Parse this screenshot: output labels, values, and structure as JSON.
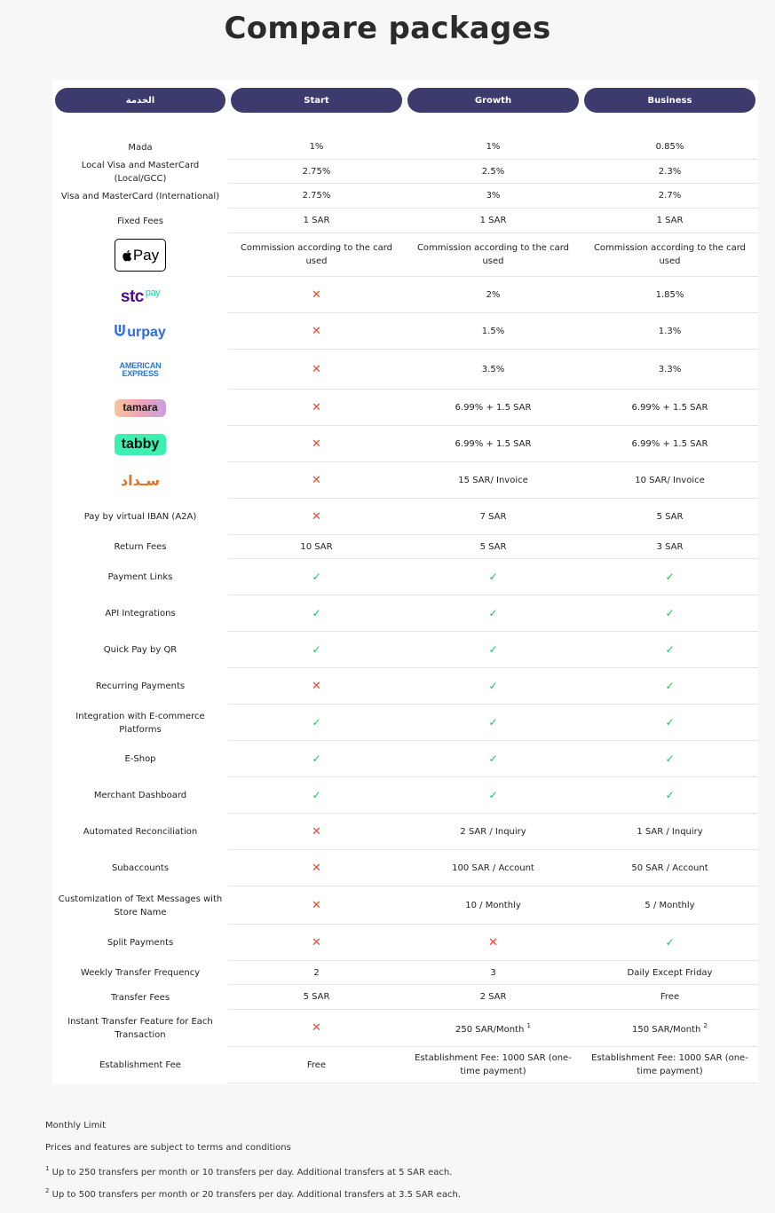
{
  "title": "Compare packages",
  "headers": [
    "الخدمة",
    "Start",
    "Growth",
    "Business"
  ],
  "logos": {
    "applepay_text": "Pay",
    "stc_text": "stc",
    "stc_pay_text": "pay",
    "urpay_text": "urpay",
    "amex_line1": "AMERICAN",
    "amex_line2": "EXPRESS",
    "tamara_text": "tamara",
    "tabby_text": "tabby",
    "sadad_text": "سـداد"
  },
  "rows": [
    {
      "label": "Mada",
      "start": "1%",
      "growth": "1%",
      "business": "0.85%"
    },
    {
      "label": "Local Visa and MasterCard (Local/GCC)",
      "start": "2.75%",
      "growth": "2.5%",
      "business": "2.3%"
    },
    {
      "label": "Visa and MasterCard (International)",
      "start": "2.75%",
      "growth": "3%",
      "business": "2.7%"
    },
    {
      "label": "Fixed Fees",
      "start": "1 SAR",
      "growth": "1 SAR",
      "business": "1 SAR"
    },
    {
      "logo": "applepay",
      "start": "Commission according to the card used",
      "growth": "Commission according to the card used",
      "business": "Commission according to the card used"
    },
    {
      "logo": "stc",
      "start": "✕",
      "growth": "2%",
      "business": "1.85%"
    },
    {
      "logo": "urpay",
      "start": "✕",
      "growth": "1.5%",
      "business": "1.3%"
    },
    {
      "logo": "amex",
      "start": "✕",
      "growth": "3.5%",
      "business": "3.3%"
    },
    {
      "logo": "tamara",
      "start": "✕",
      "growth": "6.99% + 1.5 SAR",
      "business": "6.99% + 1.5 SAR"
    },
    {
      "logo": "tabby",
      "start": "✕",
      "growth": "6.99% + 1.5 SAR",
      "business": "6.99% + 1.5 SAR"
    },
    {
      "logo": "sadad",
      "start": "✕",
      "growth": "15 SAR/ Invoice",
      "business": "10 SAR/ Invoice"
    },
    {
      "label": "Pay by virtual IBAN (A2A)",
      "start": "✕",
      "growth": "7 SAR",
      "business": "5 SAR"
    },
    {
      "label": "Return Fees",
      "start": "10 SAR",
      "growth": "5 SAR",
      "business": "3 SAR"
    },
    {
      "label": "Payment Links",
      "start": "✓",
      "growth": "✓",
      "business": "✓"
    },
    {
      "label": "API Integrations",
      "start": "✓",
      "growth": "✓",
      "business": "✓"
    },
    {
      "label": "Quick Pay by QR",
      "start": "✓",
      "growth": "✓",
      "business": "✓"
    },
    {
      "label": "Recurring Payments",
      "start": "✕",
      "growth": "✓",
      "business": "✓"
    },
    {
      "label": "Integration with E-commerce Platforms",
      "start": "✓",
      "growth": "✓",
      "business": "✓"
    },
    {
      "label": "E-Shop",
      "start": "✓",
      "growth": "✓",
      "business": "✓"
    },
    {
      "label": "Merchant Dashboard",
      "start": "✓",
      "growth": "✓",
      "business": "✓"
    },
    {
      "label": "Automated Reconciliation",
      "start": "✕",
      "growth": "2 SAR / Inquiry",
      "business": "1 SAR / Inquiry"
    },
    {
      "label": "Subaccounts",
      "start": "✕",
      "growth": "100 SAR / Account",
      "business": "50 SAR / Account"
    },
    {
      "label": "Customization of Text Messages with Store Name",
      "start": "✕",
      "growth": "10 / Monthly",
      "business": "5 / Monthly"
    },
    {
      "label": "Split Payments",
      "start": "✕",
      "growth": "✕",
      "business": "✓"
    },
    {
      "label": "Weekly Transfer Frequency",
      "start": "2",
      "growth": "3",
      "business": "Daily Except Friday"
    },
    {
      "label": "Transfer Fees",
      "start": "5 SAR",
      "growth": "2 SAR",
      "business": "Free"
    },
    {
      "label": "Instant Transfer Feature for Each Transaction",
      "start": "✕",
      "growth": "250 SAR/Month",
      "growth_sup": "1",
      "business": "150 SAR/Month",
      "business_sup": "2"
    },
    {
      "label": "Establishment Fee",
      "start": "Free",
      "growth": "Establishment Fee: 1000 SAR (one-time payment)",
      "business": "Establishment Fee: 1000 SAR (one-time payment)"
    }
  ],
  "notes": {
    "monthly_limit": "Monthly Limit",
    "terms": "Prices and features are subject to terms and conditions",
    "note1_sup": "1",
    "note1": "Up to 250 transfers per month or 10 transfers per day. Additional transfers at 5 SAR each.",
    "note2_sup": "2",
    "note2": "Up to 500 transfers per month or 20 transfers per day. Additional transfers at 3.5 SAR each."
  },
  "colors": {
    "header_pill": "#3d3b6d",
    "cross": "#f0452f",
    "check": "#16c55a"
  }
}
